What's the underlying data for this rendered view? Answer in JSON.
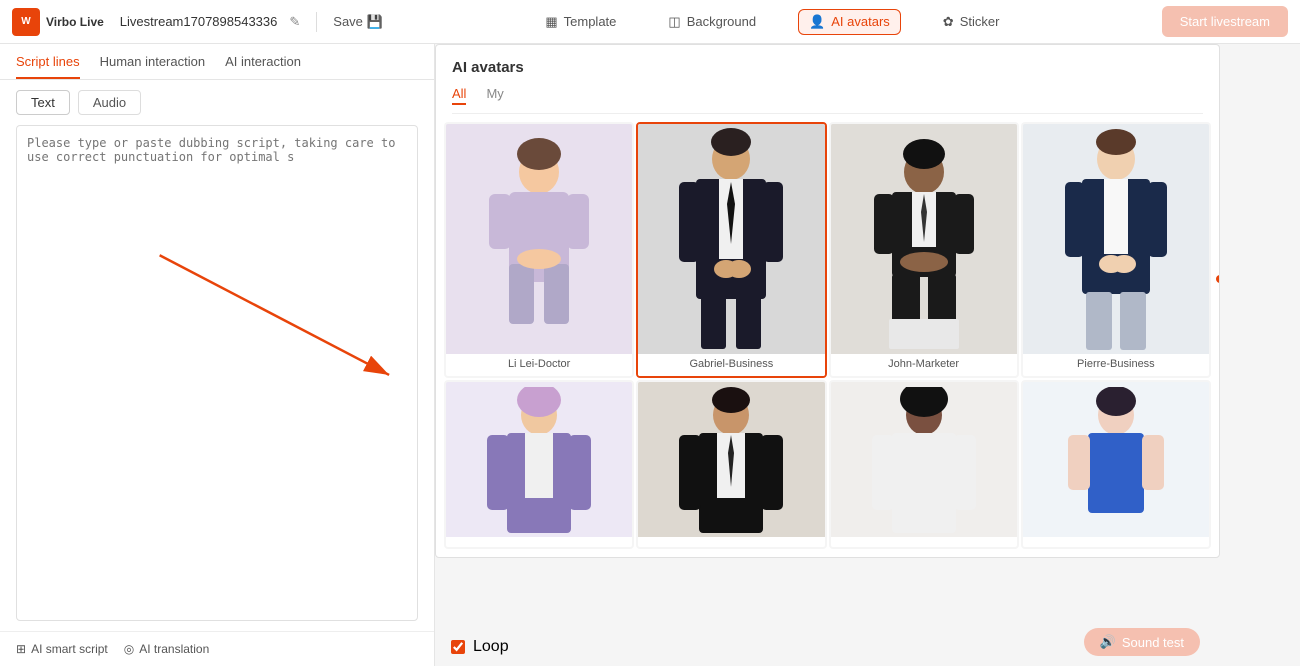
{
  "header": {
    "logo_text": "Virbo Live",
    "livestream_name": "Livestream1707898543336",
    "save_label": "Save",
    "nav_items": [
      {
        "id": "template",
        "label": "Template",
        "icon": "▦"
      },
      {
        "id": "background",
        "label": "Background",
        "icon": "◫"
      },
      {
        "id": "ai_avatars",
        "label": "AI avatars",
        "icon": "👤",
        "active": true
      },
      {
        "id": "sticker",
        "label": "Sticker",
        "icon": "✿"
      }
    ],
    "start_btn": "Start livestream"
  },
  "left_panel": {
    "script_tabs": [
      {
        "id": "script_lines",
        "label": "Script lines",
        "active": true
      },
      {
        "id": "human_interaction",
        "label": "Human interaction"
      },
      {
        "id": "ai_interaction",
        "label": "AI interaction"
      }
    ],
    "text_audio": [
      {
        "id": "text",
        "label": "Text",
        "active": true
      },
      {
        "id": "audio",
        "label": "Audio"
      }
    ],
    "textarea_placeholder": "Please type or paste dubbing script, taking care to use correct punctuation for optimal s",
    "bottom_buttons": [
      {
        "id": "ai_smart_script",
        "label": "AI smart script",
        "icon": "⊞"
      },
      {
        "id": "ai_translation",
        "label": "AI translation",
        "icon": "◎"
      }
    ]
  },
  "avatar_panel": {
    "title": "AI avatars",
    "filter_tabs": [
      {
        "id": "all",
        "label": "All",
        "active": true
      },
      {
        "id": "my",
        "label": "My"
      }
    ],
    "avatars_row1": [
      {
        "id": "li_lei",
        "name": "Li Lei-Doctor",
        "selected": false,
        "bg": "#e8e0ee"
      },
      {
        "id": "gabriel",
        "name": "Gabriel-Business",
        "selected": true,
        "bg": "#2a2a2a"
      },
      {
        "id": "john",
        "name": "John-Marketer",
        "selected": false,
        "bg": "#d8d8d8"
      },
      {
        "id": "pierre",
        "name": "Pierre-Business",
        "selected": false,
        "bg": "#e8ecf0"
      }
    ],
    "avatars_row2": [
      {
        "id": "avatar5",
        "name": "",
        "selected": false,
        "bg": "#e8e0f0"
      },
      {
        "id": "avatar6",
        "name": "",
        "selected": false,
        "bg": "#1a1a1a"
      },
      {
        "id": "avatar7",
        "name": "",
        "selected": false,
        "bg": "#f0f0f0"
      },
      {
        "id": "avatar8",
        "name": "",
        "selected": false,
        "bg": "#f0f4f8"
      }
    ]
  },
  "bottom_bar": {
    "loop_label": "Loop",
    "sound_test_label": "Sound test",
    "sound_icon": "🔊"
  }
}
